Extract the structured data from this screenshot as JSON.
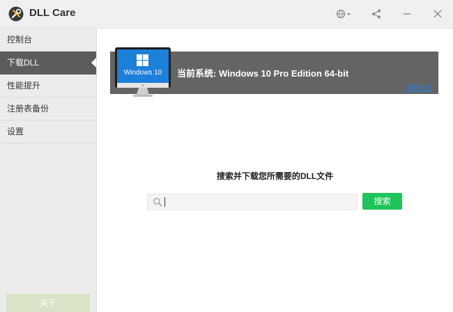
{
  "app": {
    "title": "DLL Care"
  },
  "sidebar": {
    "items": [
      {
        "label": "控制台"
      },
      {
        "label": "下载DLL",
        "active": true
      },
      {
        "label": "性能提升"
      },
      {
        "label": "注册表备份"
      },
      {
        "label": "设置"
      }
    ],
    "about_label": "关于"
  },
  "system": {
    "monitor_label": "Windows 10",
    "current_system": "当前系统: Windows 10 Pro Edition  64-bit",
    "detail_link": "详细信息"
  },
  "search": {
    "title": "搜索并下载您所需要的DLL文件",
    "value": "",
    "button_label": "搜索"
  },
  "colors": {
    "accent_green": "#1fc45b",
    "banner_gray": "#646464",
    "sidebar_active": "#5c5c5c",
    "link_blue": "#2b7bd6"
  },
  "icons": {
    "logo": "screwdriver-wrench-icon",
    "language": "globe-icon",
    "share": "share-icon",
    "minimize": "minimize-icon",
    "close": "close-icon",
    "search": "magnifier-icon"
  }
}
